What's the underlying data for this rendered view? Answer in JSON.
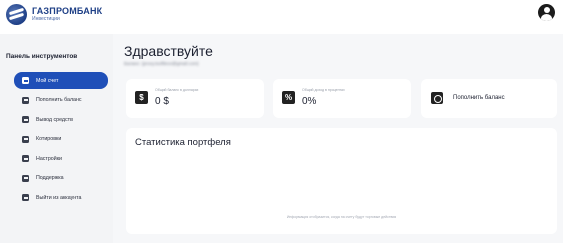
{
  "header": {
    "logo_title": "ГАЗПРОМБАНК",
    "logo_subtitle": "Инвестиции"
  },
  "sidebar": {
    "title": "Панель инструментов",
    "items": [
      {
        "label": "Мой счет",
        "active": true
      },
      {
        "label": "Пополнить баланс",
        "active": false
      },
      {
        "label": "Вывод средств",
        "active": false
      },
      {
        "label": "Котировки",
        "active": false
      },
      {
        "label": "Настройки",
        "active": false
      },
      {
        "label": "Поддержка",
        "active": false
      },
      {
        "label": "Выйти из аккаунта",
        "active": false
      }
    ]
  },
  "main": {
    "greeting": "Здравствуйте",
    "email_line": "Баланс: {proxy.tsoftlevo@gmail.com}",
    "cards": {
      "balance": {
        "icon": "$",
        "label": "Общий баланс в долларах",
        "value": "0 $"
      },
      "income": {
        "icon": "%",
        "label": "Общий доход в процентах",
        "value": "0%"
      },
      "topup": {
        "label": "Пополнить баланс"
      }
    },
    "stats": {
      "title": "Статистика портфеля",
      "empty_text": "Информация отобразится, когда на счету будут торговые действия"
    }
  },
  "colors": {
    "accent": "#1f4fb8",
    "sidebar_bg": "#f3f4f6",
    "main_bg": "#f6f7f9"
  }
}
